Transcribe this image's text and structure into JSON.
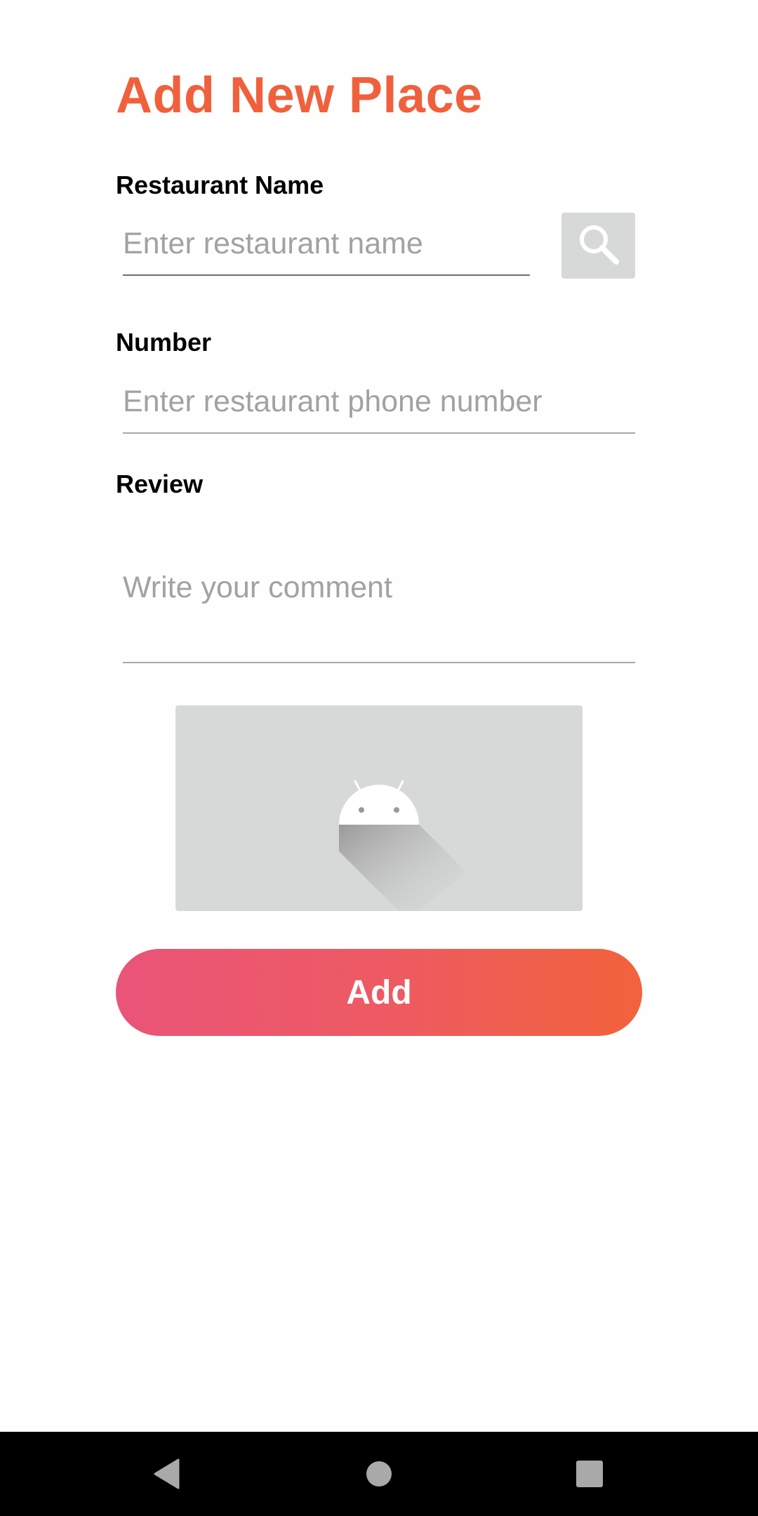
{
  "header": {
    "title": "Add New Place"
  },
  "form": {
    "restaurant_name": {
      "label": "Restaurant Name",
      "placeholder": "Enter restaurant name",
      "value": ""
    },
    "number": {
      "label": "Number",
      "placeholder": "Enter restaurant phone number",
      "value": ""
    },
    "review": {
      "label": "Review",
      "placeholder": "Write your comment",
      "value": ""
    },
    "search_button_icon": "search-icon",
    "image_placeholder_icon": "android-icon",
    "submit_label": "Add"
  },
  "system_nav": {
    "back_icon": "triangle-back-icon",
    "home_icon": "circle-home-icon",
    "recents_icon": "square-recents-icon"
  },
  "colors": {
    "accent": "#f0603c",
    "button_gradient_start": "#ea5478",
    "button_gradient_end": "#f2623b",
    "placeholder_gray": "#d7d8d8",
    "navbar": "#000000"
  }
}
